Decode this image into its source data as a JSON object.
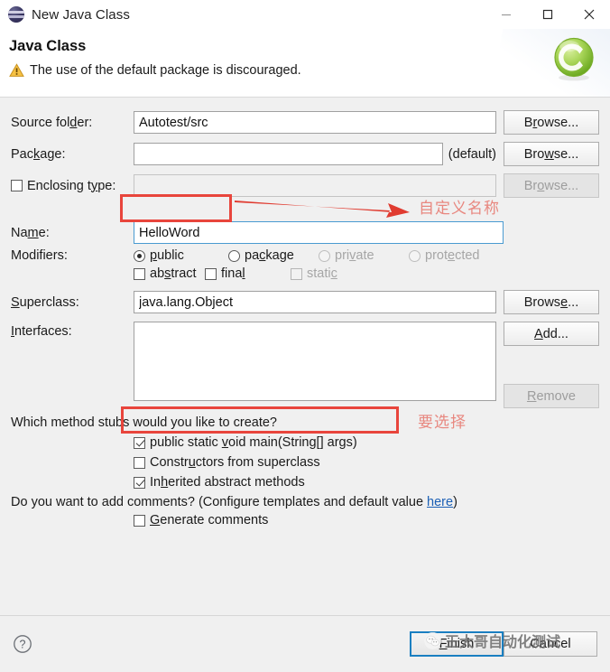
{
  "window": {
    "title": "New Java Class",
    "icon": "eclipse-sphere-icon",
    "controls": {
      "minimize": "minimize-icon",
      "maximize": "maximize-icon",
      "close": "close-icon"
    }
  },
  "header": {
    "title": "Java Class",
    "message": "The use of the default package is discouraged.",
    "message_icon": "warning-icon",
    "badge_letter": "C",
    "badge_color": "#8cc63f"
  },
  "form": {
    "source_folder": {
      "label": "Source folder:",
      "value": "Autotest/src",
      "button": "Browse..."
    },
    "package": {
      "label": "Package:",
      "value": "",
      "suffix": "(default)",
      "button": "Browse..."
    },
    "enclosing_type": {
      "label": "Enclosing type:",
      "checked": false,
      "value": "",
      "button": "Browse...",
      "disabled": true
    },
    "name": {
      "label": "Name:",
      "value": "HelloWord"
    },
    "modifiers": {
      "label": "Modifiers:",
      "access": [
        {
          "label": "public",
          "checked": true,
          "disabled": false
        },
        {
          "label": "package",
          "checked": false,
          "disabled": false
        },
        {
          "label": "private",
          "checked": false,
          "disabled": true
        },
        {
          "label": "protected",
          "checked": false,
          "disabled": true
        }
      ],
      "flags": [
        {
          "label": "abstract",
          "checked": false,
          "disabled": false
        },
        {
          "label": "final",
          "checked": false,
          "disabled": false
        },
        {
          "label": "static",
          "checked": false,
          "disabled": true
        }
      ]
    },
    "superclass": {
      "label": "Superclass:",
      "value": "java.lang.Object",
      "button": "Browse..."
    },
    "interfaces": {
      "label": "Interfaces:",
      "items": [],
      "add_button": "Add...",
      "remove_button": "Remove",
      "remove_disabled": true
    }
  },
  "stubs": {
    "question": "Which method stubs would you like to create?",
    "items": [
      {
        "label": "public static void main(String[] args)",
        "checked": true
      },
      {
        "label": "Constructors from superclass",
        "checked": false
      },
      {
        "label": "Inherited abstract methods",
        "checked": true
      }
    ]
  },
  "comments": {
    "question_prefix": "Do you want to add comments? (Configure templates and default value ",
    "link": "here",
    "question_suffix": ")",
    "generate": {
      "label": "Generate comments",
      "checked": false
    }
  },
  "footer": {
    "help_icon": "help-icon",
    "finish": "Finish",
    "cancel": "Cancel"
  },
  "annotations": {
    "name_note": "自定义名称",
    "stub_note": "要选择",
    "accent_red": "#e8453c",
    "note_color": "#e8877f"
  },
  "watermark": {
    "text": "王大哥自动化测试",
    "logo": "wechat-logo-icon"
  }
}
